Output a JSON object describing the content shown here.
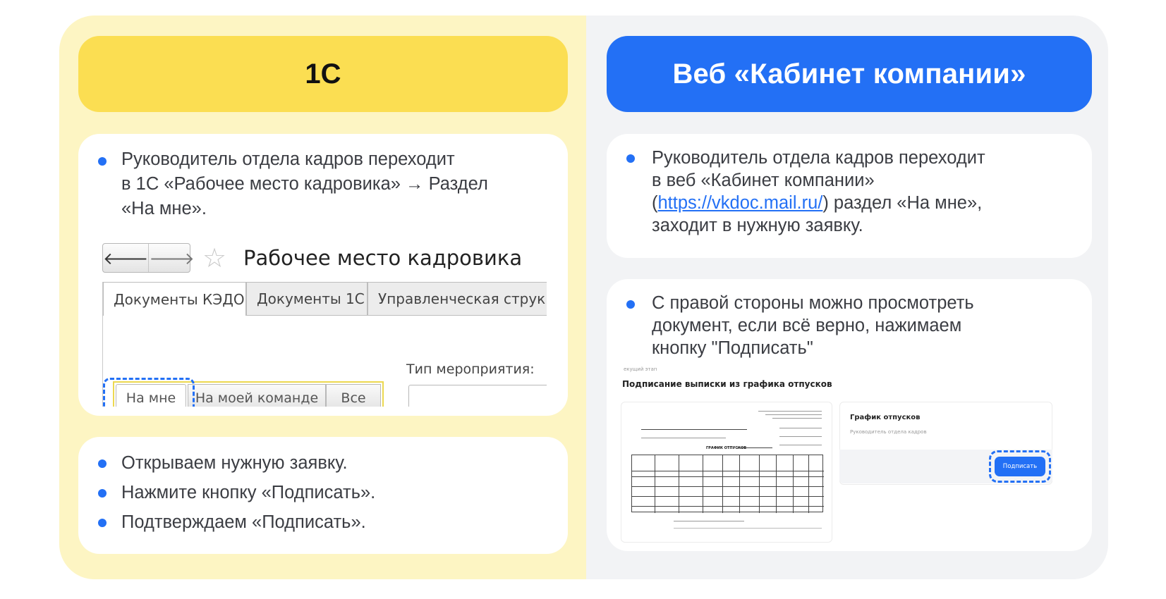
{
  "left": {
    "header": "1C",
    "card1": {
      "lines": [
        "Руководитель отдела кадров переходит",
        "в 1С «Рабочее место кадровика» → Раздел",
        "«На мне»."
      ],
      "screenshot": {
        "title": "Рабочее место кадровика",
        "nav_back": "🡐",
        "nav_forward": "🡒",
        "star": "☆",
        "tabs": [
          "Документы КЭДО",
          "Документы 1С",
          "Управленческая струк"
        ],
        "type_label": "Тип мероприятия:",
        "segments": [
          "На мне",
          "На моей команде",
          "Все"
        ]
      }
    },
    "card2": {
      "items": [
        "Открываем нужную заявку.",
        "Нажмите кнопку «Подписать».",
        "Подтверждаем «Подписать»."
      ]
    }
  },
  "right": {
    "header": "Веб «Кабинет компании»",
    "card3": {
      "line1": "Руководитель отдела кадров переходит",
      "line2": "в веб «Кабинет компании»",
      "paren_open": "(",
      "link": "https://vkdoc.mail.ru/",
      "line3_rest": ") раздел «На мне»,",
      "line4": "заходит в нужную заявку."
    },
    "card4": {
      "lines": [
        "С правой стороны можно просмотреть",
        "документ, если всё верно, нажимаем",
        "кнопку \"Подписать\""
      ],
      "screenshot": {
        "stage": "екущий этап",
        "title": "Подписание выписки из графика отпусков",
        "doc_heading": "ГРАФИК ОТПУСКОВ",
        "side_title": "График отпусков",
        "side_sub": "Руководитель отдела кадров",
        "sign_button": "Подписать"
      }
    }
  },
  "colors": {
    "yellow_bg": "#fdf5c3",
    "yellow_header": "#fbde52",
    "blue": "#2370f5",
    "grey_bg": "#f2f3f5"
  }
}
